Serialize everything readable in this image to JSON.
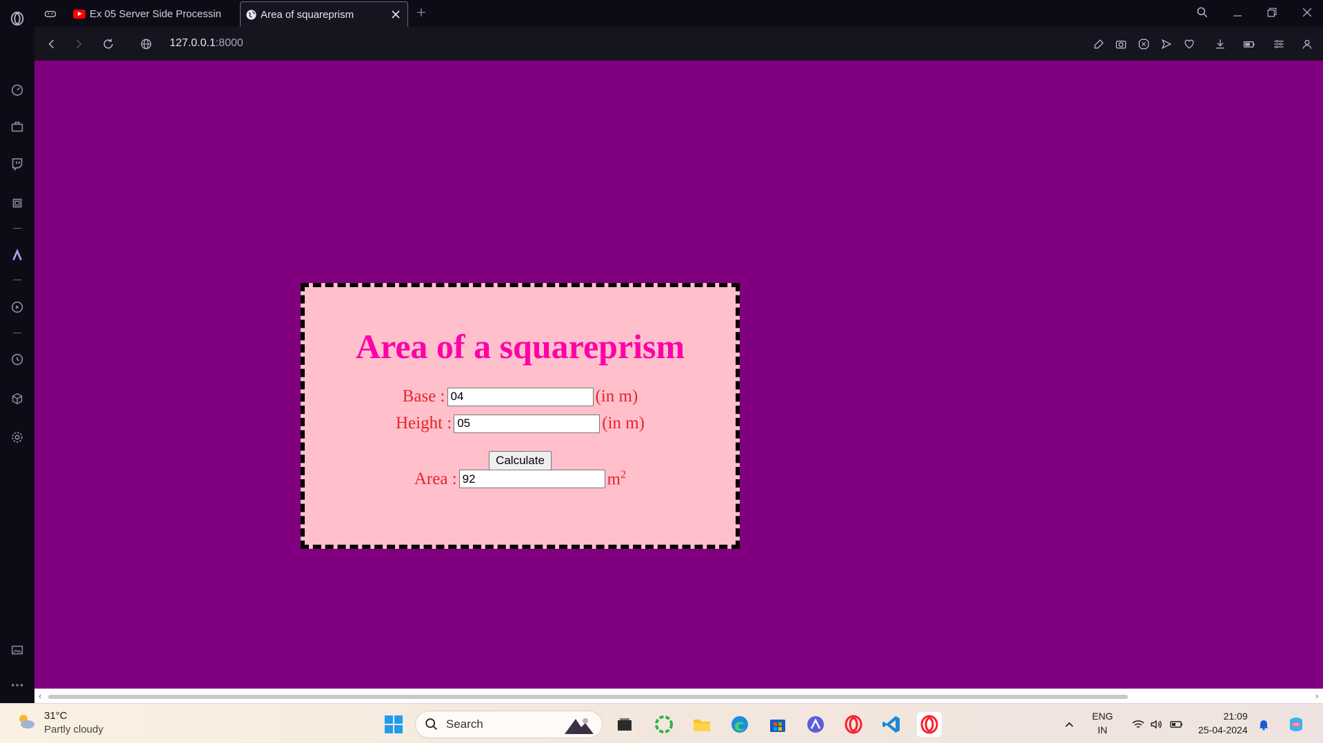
{
  "tabs": [
    {
      "label": "Ex 05 Server Side Processin",
      "favicon": "youtube-icon"
    },
    {
      "label": "Area of squareprism",
      "favicon": "globe-icon"
    }
  ],
  "address": {
    "host": "127.0.0.1",
    "port": ":8000"
  },
  "page": {
    "title": "Area of a squareprism",
    "base_label": "Base :",
    "base_value": "04",
    "height_label": "Height :",
    "height_value": "05",
    "unit_hint": "(in m)",
    "button_label": "Calculate",
    "area_label": "Area :",
    "area_value": "92",
    "area_unit": "m",
    "area_unit_sup": "2"
  },
  "taskbar": {
    "temperature": "31°C",
    "weather": "Partly cloudy",
    "search_placeholder": "Search",
    "lang_top": "ENG",
    "lang_bottom": "IN",
    "time": "21:09",
    "date": "25-04-2024"
  },
  "colors": {
    "page_bg": "#800080",
    "card_bg": "#ffc0cb",
    "title": "#ff00a8",
    "label": "#e8232a"
  }
}
